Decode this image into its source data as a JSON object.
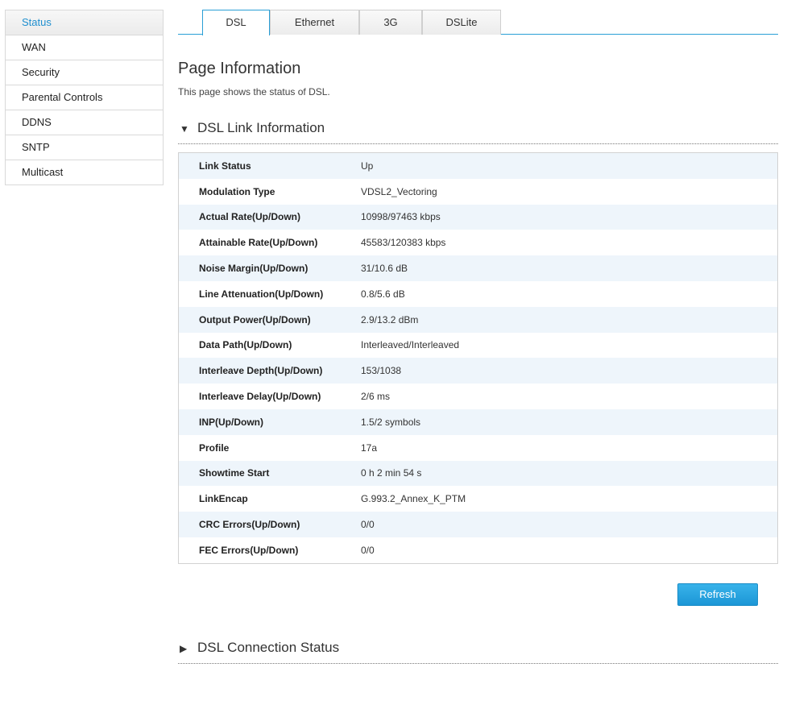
{
  "sidebar": {
    "items": [
      {
        "label": "Status",
        "active": true
      },
      {
        "label": "WAN"
      },
      {
        "label": "Security"
      },
      {
        "label": "Parental Controls"
      },
      {
        "label": "DDNS"
      },
      {
        "label": "SNTP"
      },
      {
        "label": "Multicast"
      }
    ]
  },
  "tabs": [
    {
      "label": "DSL",
      "active": true
    },
    {
      "label": "Ethernet"
    },
    {
      "label": "3G"
    },
    {
      "label": "DSLite"
    }
  ],
  "page": {
    "title": "Page Information",
    "description": "This page shows the status of DSL."
  },
  "link_section": {
    "title": "DSL Link Information",
    "expanded_icon": "▼",
    "rows": [
      {
        "label": "Link Status",
        "value": "Up"
      },
      {
        "label": "Modulation Type",
        "value": "VDSL2_Vectoring"
      },
      {
        "label": "Actual Rate(Up/Down)",
        "value": "10998/97463 kbps"
      },
      {
        "label": "Attainable Rate(Up/Down)",
        "value": "45583/120383 kbps"
      },
      {
        "label": "Noise Margin(Up/Down)",
        "value": "31/10.6 dB"
      },
      {
        "label": "Line Attenuation(Up/Down)",
        "value": "0.8/5.6 dB"
      },
      {
        "label": "Output Power(Up/Down)",
        "value": "2.9/13.2 dBm"
      },
      {
        "label": "Data Path(Up/Down)",
        "value": "Interleaved/Interleaved"
      },
      {
        "label": "Interleave Depth(Up/Down)",
        "value": "153/1038"
      },
      {
        "label": "Interleave Delay(Up/Down)",
        "value": "2/6 ms"
      },
      {
        "label": "INP(Up/Down)",
        "value": "1.5/2 symbols"
      },
      {
        "label": "Profile",
        "value": "17a"
      },
      {
        "label": "Showtime Start",
        "value": "0 h 2 min 54 s"
      },
      {
        "label": "LinkEncap",
        "value": "G.993.2_Annex_K_PTM"
      },
      {
        "label": "CRC Errors(Up/Down)",
        "value": "0/0"
      },
      {
        "label": "FEC Errors(Up/Down)",
        "value": "0/0"
      }
    ]
  },
  "refresh_label": "Refresh",
  "connection_section": {
    "title": "DSL Connection Status",
    "collapsed_icon": "▶"
  },
  "colors": {
    "accent": "#2a9fd6",
    "button": "#1c96d6",
    "row_alt": "#eef5fb",
    "active_text": "#1f8fcf"
  }
}
